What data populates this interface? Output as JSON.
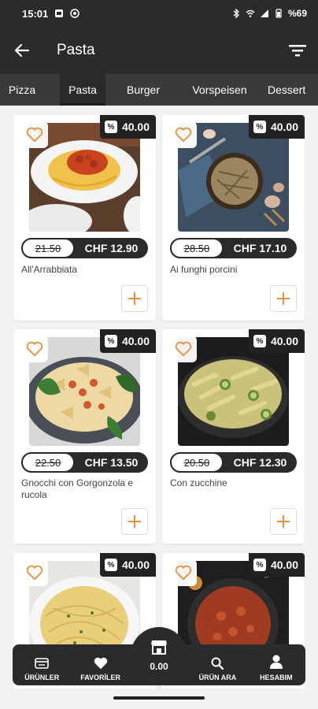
{
  "status": {
    "time": "15:01",
    "battery": "%69"
  },
  "header": {
    "title": "Pasta"
  },
  "tabs": [
    "Pizza",
    "Pasta",
    "Burger",
    "Vorspeisen",
    "Dessert"
  ],
  "products": [
    {
      "name": "All'Arrabbiata",
      "discount": "40.00",
      "old_price": "21.50",
      "price": "CHF 12.90"
    },
    {
      "name": "Ai funghi porcini",
      "discount": "40.00",
      "old_price": "28.50",
      "price": "CHF 17.10"
    },
    {
      "name": "Gnocchi con Gorgonzola e rucola",
      "discount": "40.00",
      "old_price": "22.50",
      "price": "CHF 13.50"
    },
    {
      "name": "Con zucchine",
      "discount": "40.00",
      "old_price": "20.50",
      "price": "CHF 12.30"
    },
    {
      "name": "",
      "discount": "40.00",
      "old_price": "",
      "price": ""
    },
    {
      "name": "",
      "discount": "40.00",
      "old_price": "",
      "price": ""
    }
  ],
  "bottom_nav": {
    "products": "ÜRÜNLER",
    "favorites": "FAVORİLER",
    "cart_total": "0.00",
    "search": "ÜRÜN ARA",
    "account": "HESABIM"
  },
  "colors": {
    "accent": "#e8913a",
    "dark": "#2b2b2e"
  }
}
